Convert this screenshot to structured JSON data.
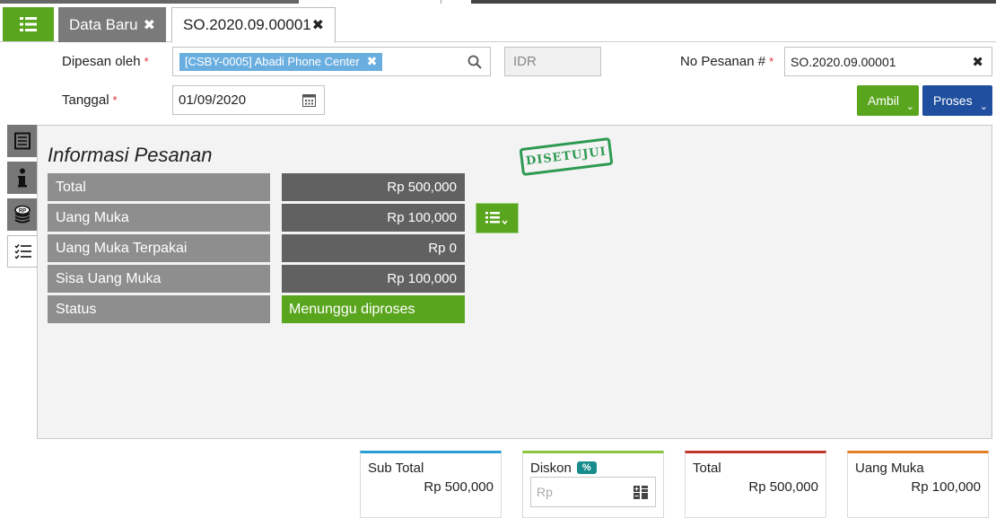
{
  "tabs": {
    "menu_icon": "list-icon",
    "items": [
      {
        "label": "Data Baru",
        "active": false
      },
      {
        "label": "SO.2020.09.00001",
        "active": true
      }
    ]
  },
  "form": {
    "ordered_by": {
      "label": "Dipesan oleh",
      "value": "[CSBY-0005] Abadi Phone Center"
    },
    "currency": {
      "value": "IDR"
    },
    "order_no": {
      "label": "No Pesanan #",
      "value": "SO.2020.09.00001"
    },
    "date": {
      "label": "Tanggal",
      "value": "01/09/2020"
    },
    "required_mark": "*"
  },
  "buttons": {
    "ambil": "Ambil",
    "proses": "Proses"
  },
  "side_tabs": [
    {
      "icon": "document-icon",
      "active": false
    },
    {
      "icon": "info-icon",
      "active": false
    },
    {
      "icon": "coins-icon",
      "active": false
    },
    {
      "icon": "checklist-icon",
      "active": true
    }
  ],
  "info_panel": {
    "title": "Informasi Pesanan",
    "stamp": "DISETUJUI",
    "rows": [
      {
        "label": "Total",
        "value": "Rp 500,000"
      },
      {
        "label": "Uang Muka",
        "value": "Rp 100,000"
      },
      {
        "label": "Uang Muka Terpakai",
        "value": "Rp 0"
      },
      {
        "label": "Sisa Uang Muka",
        "value": "Rp 100,000"
      },
      {
        "label": "Status",
        "value": "Menunggu diproses"
      }
    ]
  },
  "summary": {
    "subtotal": {
      "label": "Sub Total",
      "value": "Rp 500,000",
      "color": "#2a9fd6"
    },
    "diskon": {
      "label": "Diskon",
      "badge": "%",
      "placeholder": "Rp",
      "color": "#8cc63f"
    },
    "total": {
      "label": "Total",
      "value": "Rp 500,000",
      "color": "#c0392b"
    },
    "uang_muka": {
      "label": "Uang Muka",
      "value": "Rp 100,000",
      "color": "#e67e22"
    }
  },
  "colors": {
    "primary_green": "#5aa51e",
    "primary_blue": "#1f4f9e",
    "chip_blue": "#6aaee0"
  }
}
